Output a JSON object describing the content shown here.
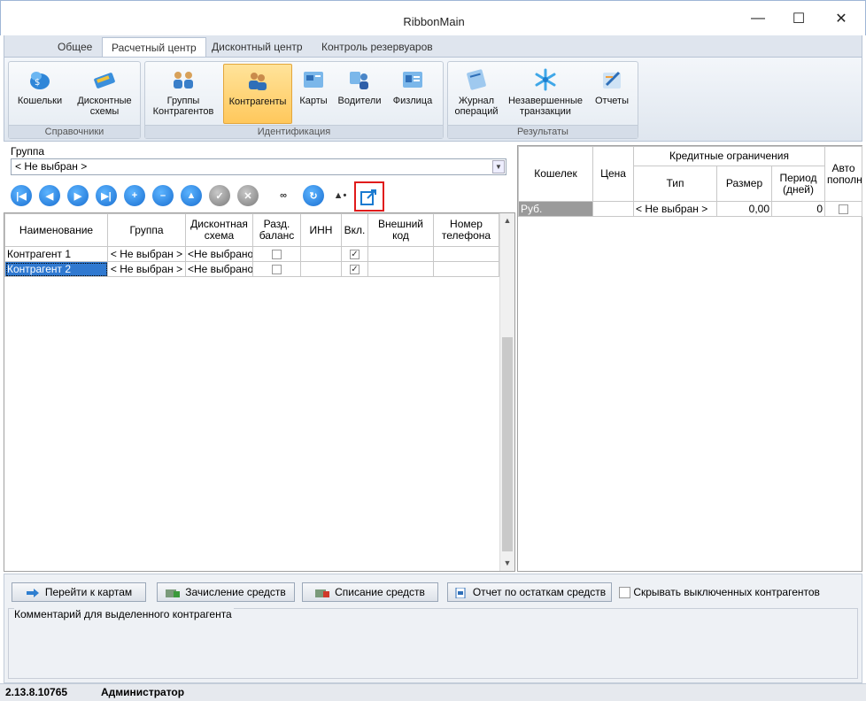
{
  "window": {
    "title": "RibbonMain"
  },
  "ribbon": {
    "tabs": [
      "Общее",
      "Расчетный центр",
      "Дисконтный центр",
      "Контроль резервуаров"
    ],
    "active_tab_index": 1,
    "groups": [
      {
        "label": "Справочники",
        "buttons": [
          {
            "label": "Кошельки",
            "icon": "wallet-icon"
          },
          {
            "label": "Дисконтные схемы",
            "icon": "discount-card-icon"
          }
        ]
      },
      {
        "label": "Идентификация",
        "buttons": [
          {
            "label": "Группы Контрагентов",
            "icon": "groups-icon"
          },
          {
            "label": "Контрагенты",
            "icon": "contractors-icon"
          },
          {
            "label": "Карты",
            "icon": "cards-icon"
          },
          {
            "label": "Водители",
            "icon": "drivers-icon"
          },
          {
            "label": "Физлица",
            "icon": "individuals-icon"
          }
        ]
      },
      {
        "label": "Результаты",
        "buttons": [
          {
            "label": "Журнал операций",
            "icon": "journal-icon"
          },
          {
            "label": "Незавершенные транзакции",
            "icon": "snowflake-icon"
          },
          {
            "label": "Отчеты",
            "icon": "reports-icon"
          }
        ]
      }
    ],
    "selected_button": "Контрагенты"
  },
  "filter": {
    "group_label": "Группа",
    "group_value": "< Не выбран >"
  },
  "left_grid": {
    "headers": [
      "Наименование",
      "Группа",
      "Дисконтная схема",
      "Разд. баланс",
      "ИНН",
      "Вкл.",
      "Внешний код",
      "Номер телефона"
    ],
    "rows": [
      {
        "name": "Контрагент 1",
        "group": "< Не выбран >",
        "scheme": "<Не выбрано",
        "split": false,
        "inn": "",
        "enabled": true,
        "ext": "",
        "phone": ""
      },
      {
        "name": "Контрагент 2",
        "group": "< Не выбран >",
        "scheme": "<Не выбрано",
        "split": false,
        "inn": "",
        "enabled": true,
        "ext": "",
        "phone": ""
      }
    ],
    "selected_row": 1
  },
  "right_grid": {
    "headers": {
      "wallet": "Кошелек",
      "price": "Цена",
      "credit": "Кредитные ограничения",
      "type": "Тип",
      "size": "Размер",
      "period": "Период (дней)",
      "auto": "Авто пополнение"
    },
    "rows": [
      {
        "wallet": "Руб.",
        "price": "",
        "type": "< Не выбран >",
        "size": "0,00",
        "period": "0",
        "auto": false
      }
    ]
  },
  "bottom": {
    "buttons": [
      "Перейти к картам",
      "Зачисление средств",
      "Списание средств",
      "Отчет по остаткам средств"
    ],
    "hide_disabled_label": "Скрывать выключенных контрагентов",
    "comment_label": "Комментарий для выделенного контрагента"
  },
  "status": {
    "version": "2.13.8.10765",
    "user": "Администратор"
  }
}
